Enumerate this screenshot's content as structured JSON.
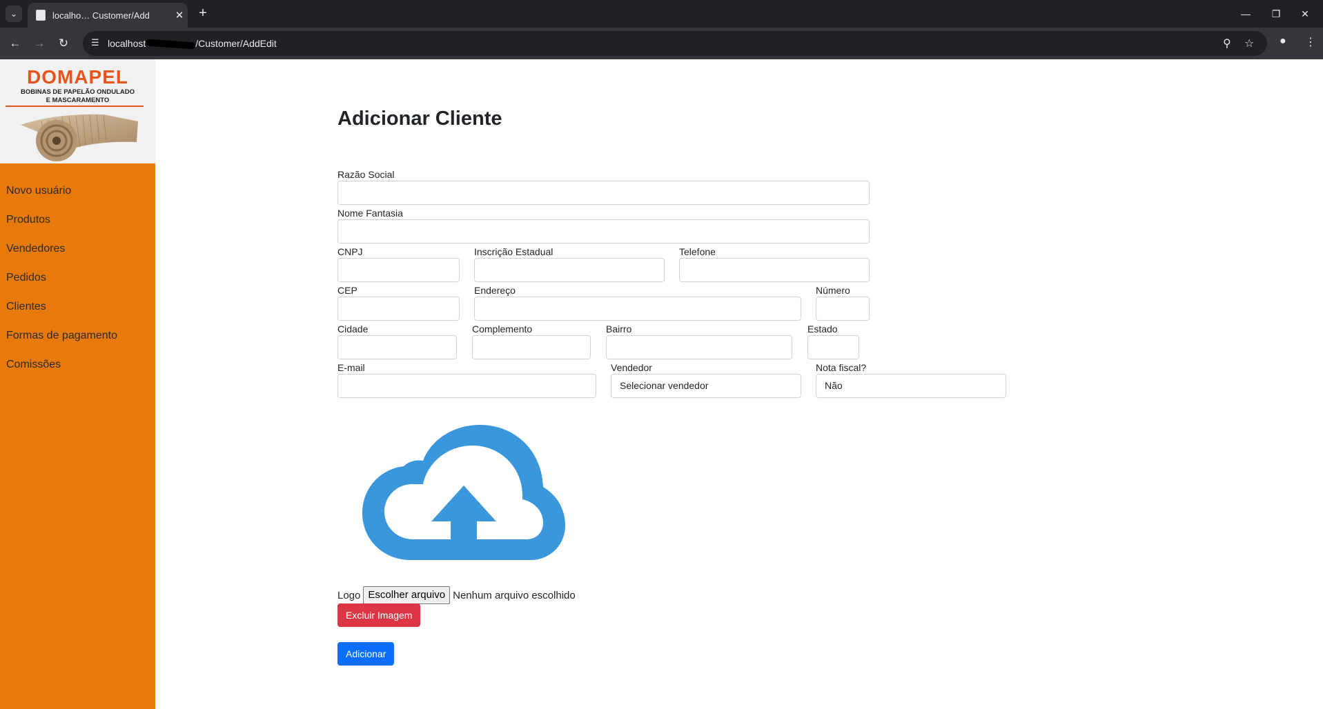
{
  "browser": {
    "tab_title": "localho… Customer/Add",
    "url": "localhost:…/Customer/AddEdit",
    "url_prefix": "localhost",
    "url_suffix": "/Customer/AddEdit"
  },
  "sidebar": {
    "logo": {
      "brand": "DOMAPEL",
      "tagline_line1": "BOBINAS DE PAPELÃO ONDULADO",
      "tagline_line2": "E MASCARAMENTO"
    },
    "items": [
      {
        "label": "Novo usuário"
      },
      {
        "label": "Produtos"
      },
      {
        "label": "Vendedores"
      },
      {
        "label": "Pedidos"
      },
      {
        "label": "Clientes"
      },
      {
        "label": "Formas de pagamento"
      },
      {
        "label": "Comissões"
      }
    ]
  },
  "main": {
    "title": "Adicionar Cliente",
    "fields": {
      "razao_social": {
        "label": "Razão Social",
        "value": ""
      },
      "nome_fantasia": {
        "label": "Nome Fantasia",
        "value": ""
      },
      "cnpj": {
        "label": "CNPJ",
        "value": ""
      },
      "inscricao_estadual": {
        "label": "Inscrição Estadual",
        "value": ""
      },
      "telefone": {
        "label": "Telefone",
        "value": ""
      },
      "cep": {
        "label": "CEP",
        "value": ""
      },
      "endereco": {
        "label": "Endereço",
        "value": ""
      },
      "numero": {
        "label": "Número",
        "value": ""
      },
      "cidade": {
        "label": "Cidade",
        "value": ""
      },
      "complemento": {
        "label": "Complemento",
        "value": ""
      },
      "bairro": {
        "label": "Bairro",
        "value": ""
      },
      "estado": {
        "label": "Estado",
        "value": ""
      },
      "email": {
        "label": "E-mail",
        "value": ""
      },
      "vendedor": {
        "label": "Vendedor",
        "selected": "Selecionar vendedor"
      },
      "nota_fiscal": {
        "label": "Nota fiscal?",
        "selected": "Não"
      }
    },
    "logo_upload": {
      "label": "Logo",
      "button": "Escolher arquivo",
      "status": "Nenhum arquivo escolhido"
    },
    "delete_image_button": "Excluir Imagem",
    "submit_button": "Adicionar"
  },
  "colors": {
    "sidebar_bg": "#e8790b",
    "cloud_icon": "#3a97dc",
    "danger": "#dc3545",
    "primary": "#0d6efd",
    "brand": "#e8541a"
  }
}
